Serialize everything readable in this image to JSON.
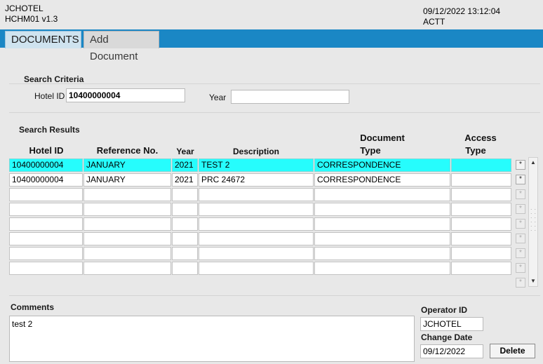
{
  "header": {
    "app_name": "JCHOTEL",
    "module": "HCHM01 v1.3",
    "datetime": "09/12/2022 13:12:04",
    "user": "ACTT"
  },
  "tabs": [
    {
      "label": "DOCUMENTS",
      "active": true
    },
    {
      "label": "Add Document",
      "active": false
    }
  ],
  "search_criteria": {
    "title": "Search Criteria",
    "hotel_id_label": "Hotel ID",
    "hotel_id_value": "10400000004",
    "year_label": "Year",
    "year_value": ""
  },
  "search_results": {
    "title": "Search Results",
    "columns": {
      "hotel_id": "Hotel ID",
      "reference_no": "Reference No.",
      "year": "Year",
      "description": "Description",
      "document_type_line1": "Document",
      "document_type_line2": "Type",
      "access_type_line1": "Access",
      "access_type_line2": "Type"
    },
    "rows": [
      {
        "hotel_id": "10400000004",
        "reference_no": "JANUARY",
        "year": "2021",
        "description": "TEST 2",
        "document_type": "CORRESPONDENCE",
        "access_type": "",
        "selected": true
      },
      {
        "hotel_id": "10400000004",
        "reference_no": "JANUARY",
        "year": "2021",
        "description": "PRC 24672",
        "document_type": "CORRESPONDENCE",
        "access_type": "",
        "selected": false
      },
      {
        "hotel_id": "",
        "reference_no": "",
        "year": "",
        "description": "",
        "document_type": "",
        "access_type": "",
        "selected": false
      },
      {
        "hotel_id": "",
        "reference_no": "",
        "year": "",
        "description": "",
        "document_type": "",
        "access_type": "",
        "selected": false
      },
      {
        "hotel_id": "",
        "reference_no": "",
        "year": "",
        "description": "",
        "document_type": "",
        "access_type": "",
        "selected": false
      },
      {
        "hotel_id": "",
        "reference_no": "",
        "year": "",
        "description": "",
        "document_type": "",
        "access_type": "",
        "selected": false
      },
      {
        "hotel_id": "",
        "reference_no": "",
        "year": "",
        "description": "",
        "document_type": "",
        "access_type": "",
        "selected": false
      },
      {
        "hotel_id": "",
        "reference_no": "",
        "year": "",
        "description": "",
        "document_type": "",
        "access_type": "",
        "selected": false
      }
    ],
    "row_button_glyph": "*"
  },
  "comments": {
    "label": "Comments",
    "value": "test 2"
  },
  "operator": {
    "operator_id_label": "Operator ID",
    "operator_id_value": "JCHOTEL",
    "change_date_label": "Change Date",
    "change_date_value": "09/12/2022"
  },
  "actions": {
    "delete_label": "Delete"
  },
  "colors": {
    "tab_bar": "#1a87c5",
    "selected_row": "#26fdfd",
    "background": "#ededed"
  },
  "icons": {
    "scroll_up": "scroll-up-arrow-icon",
    "scroll_down": "scroll-down-arrow-icon"
  }
}
